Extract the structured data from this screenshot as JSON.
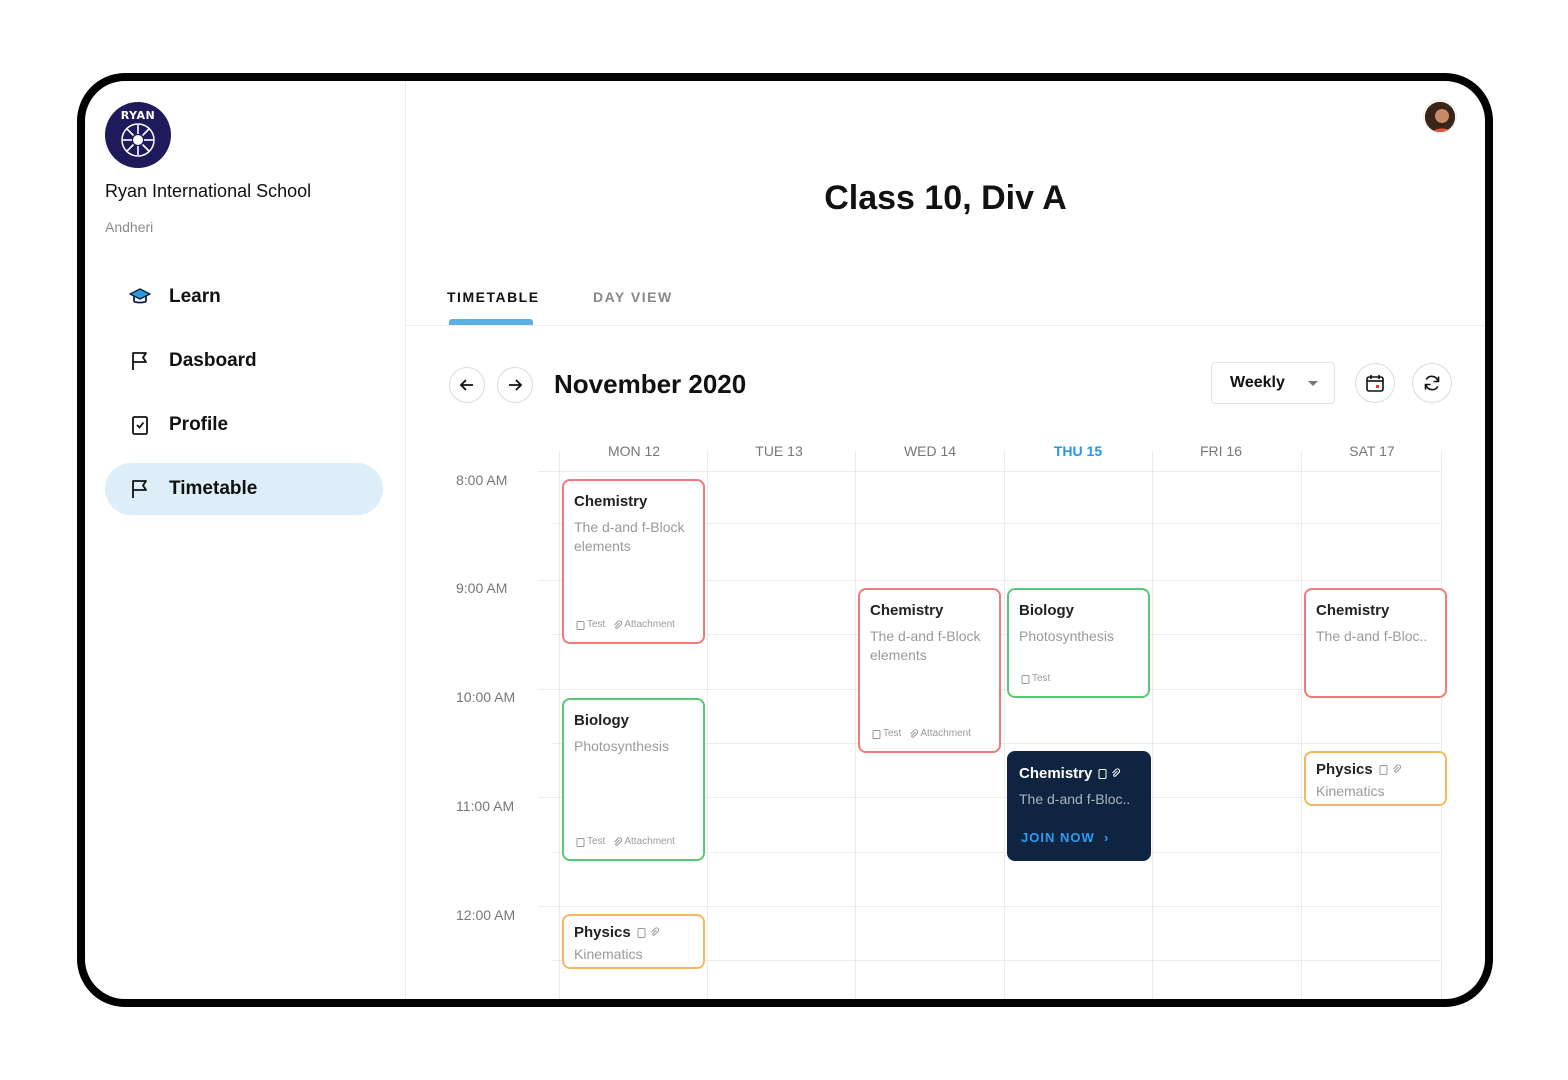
{
  "school": {
    "logo_text": "RYAN",
    "name": "Ryan International School",
    "location": "Andheri"
  },
  "nav": {
    "items": [
      {
        "label": "Learn",
        "icon": "graduation-cap-icon"
      },
      {
        "label": "Dasboard",
        "icon": "flag-icon"
      },
      {
        "label": "Profile",
        "icon": "checklist-icon"
      },
      {
        "label": "Timetable",
        "icon": "flag-icon",
        "active": true
      }
    ]
  },
  "header": {
    "title": "Class 10, Div A"
  },
  "tabs": [
    {
      "label": "TIMETABLE",
      "active": true
    },
    {
      "label": "DAY VIEW",
      "active": false
    }
  ],
  "toolbar": {
    "month": "November 2020",
    "view": "Weekly"
  },
  "days": [
    {
      "label": "MON 12",
      "today": false
    },
    {
      "label": "TUE 13",
      "today": false
    },
    {
      "label": "WED 14",
      "today": false
    },
    {
      "label": "THU 15",
      "today": true
    },
    {
      "label": "FRI 16",
      "today": false
    },
    {
      "label": "SAT 17",
      "today": false
    }
  ],
  "times": [
    "8:00 AM",
    "9:00 AM",
    "10:00 AM",
    "11:00 AM",
    "12:00 AM"
  ],
  "events": {
    "mon_chem": {
      "title": "Chemistry",
      "subtitle": "The d-and f-Block elements",
      "test": "Test",
      "attachment": "Attachment"
    },
    "mon_bio": {
      "title": "Biology",
      "subtitle": "Photosynthesis",
      "test": "Test",
      "attachment": "Attachment"
    },
    "mon_phys": {
      "title": "Physics",
      "subtitle": "Kinematics"
    },
    "wed_chem": {
      "title": "Chemistry",
      "subtitle": "The d-and f-Block elements",
      "test": "Test",
      "attachment": "Attachment"
    },
    "thu_bio": {
      "title": "Biology",
      "subtitle": "Photosynthesis",
      "test": "Test"
    },
    "thu_chem": {
      "title": "Chemistry",
      "subtitle": "The d-and f-Bloc..",
      "action": "JOIN NOW"
    },
    "sat_chem": {
      "title": "Chemistry",
      "subtitle": "The d-and f-Bloc.."
    },
    "sat_phys": {
      "title": "Physics",
      "subtitle": "Kinematics"
    }
  },
  "colors": {
    "accent": "#5ab0e4",
    "today": "#2196f3",
    "red": "#ef7a7a",
    "green": "#5ac873",
    "orange": "#f6b764",
    "dark": "#0e2440"
  }
}
